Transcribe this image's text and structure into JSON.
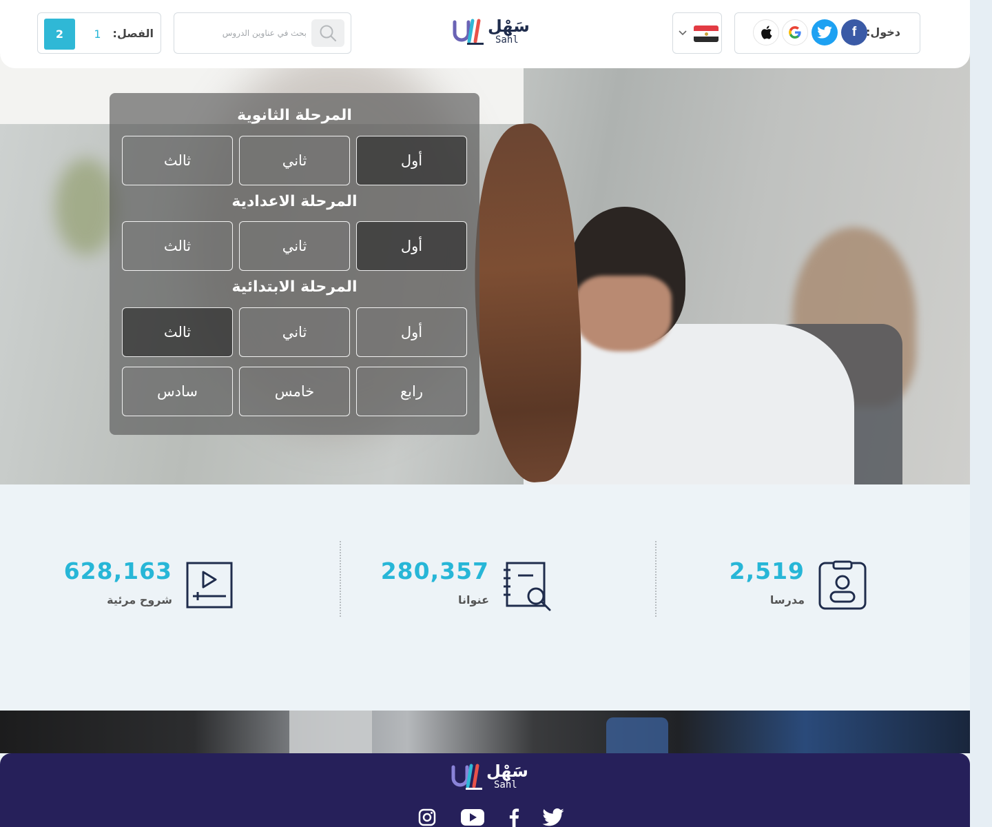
{
  "header": {
    "login_label": "دخول:",
    "social_logins": [
      {
        "name": "facebook",
        "glyph": "f"
      },
      {
        "name": "twitter",
        "glyph": "twitter-bird-icon"
      },
      {
        "name": "google",
        "glyph": "G"
      },
      {
        "name": "apple",
        "glyph": "apple-icon"
      }
    ],
    "country_flag": "egypt-flag",
    "logo_arabic": "سَهْل",
    "logo_latin": "Sahl",
    "search_placeholder": "بحث في عناوين الدروس",
    "term_label": "الفصل:",
    "term_options": [
      "1",
      "2"
    ],
    "term_selected": "2"
  },
  "grades": {
    "stages": [
      {
        "title": "المرحلة الثانوية",
        "grades": [
          "أول",
          "ثاني",
          "ثالث"
        ]
      },
      {
        "title": "المرحلة الاعدادية",
        "grades": [
          "أول",
          "ثاني",
          "ثالث"
        ]
      },
      {
        "title": "المرحلة الابتدائية",
        "grades": [
          "أول",
          "ثاني",
          "ثالث",
          "رابع",
          "خامس",
          "سادس"
        ]
      }
    ]
  },
  "stats": [
    {
      "value": "2,519",
      "label": "مدرسا",
      "icon": "teacher-badge-icon"
    },
    {
      "value": "280,357",
      "label": "عنوانا",
      "icon": "notebook-search-icon"
    },
    {
      "value": "628,163",
      "label": "شروح مرئية",
      "icon": "video-lesson-icon"
    }
  ],
  "footer": {
    "logo_arabic": "سَهْل",
    "logo_latin": "Sahl",
    "social": [
      "twitter-icon",
      "facebook-icon",
      "youtube-icon",
      "instagram-icon"
    ]
  },
  "colors": {
    "accent": "#27b6d7",
    "footer_bg": "#26205a",
    "facebook": "#3a5aa6",
    "twitter": "#1da1f2",
    "icon_navy": "#1f2c4c"
  }
}
